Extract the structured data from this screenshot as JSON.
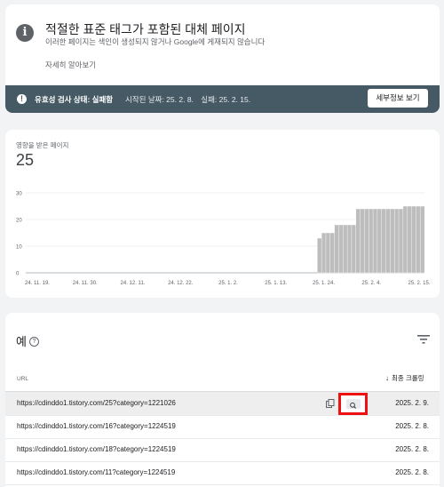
{
  "issue": {
    "title": "적절한 표준 태그가 포함된 대체 페이지",
    "description": "이러한 페이지는 색인이 생성되지 않거나 Google에 게재되지 않습니다",
    "learn_more": "자세히 알아보기",
    "status": {
      "label": "유효성 검사 상태: 실패함",
      "started": "시작된 날짜: 25. 2. 8.",
      "failed": "실패: 25. 2. 15.",
      "details_button": "세부정보 보기"
    }
  },
  "chart_card": {
    "label": "영향을 받은 페이지",
    "total": "25"
  },
  "chart_data": {
    "type": "bar",
    "title": "",
    "ylim": [
      0,
      30
    ],
    "y_ticks": [
      "0",
      "10",
      "20",
      "30"
    ],
    "x_tick_labels": [
      "24. 11. 19.",
      "24. 11. 30.",
      "24. 12. 11.",
      "24. 12. 22.",
      "25. 1. 2.",
      "25. 1. 13.",
      "25. 1. 24.",
      "25. 2. 4.",
      "25. 2. 15."
    ],
    "grid": true,
    "series": [
      {
        "values": [
          0,
          0,
          0,
          0,
          0,
          0,
          0,
          0,
          0,
          0,
          0,
          0,
          0,
          0,
          0,
          0,
          0,
          0,
          0,
          0,
          0,
          0,
          0,
          0,
          0,
          0,
          0,
          0,
          0,
          0,
          0,
          0,
          0,
          0,
          0,
          0,
          0,
          0,
          0,
          0,
          0,
          0,
          0,
          0,
          0,
          0,
          0,
          0,
          0,
          0,
          0,
          0,
          0,
          0,
          0,
          0,
          0,
          0,
          0,
          0,
          0,
          0,
          0,
          0,
          0,
          0,
          0,
          0,
          13,
          15,
          15,
          15,
          18,
          18,
          18,
          18,
          18,
          24,
          24,
          24,
          24,
          24,
          24,
          24,
          24,
          24,
          24,
          24,
          25,
          25,
          25,
          25,
          25
        ]
      }
    ]
  },
  "table": {
    "title": "예",
    "columns": {
      "url": "URL",
      "last_crawled": "최종 크롤링"
    },
    "rows": [
      {
        "url": "https://cdinddo1.tistory.com/25?category=1221026",
        "date": "2025. 2. 9."
      },
      {
        "url": "https://cdinddo1.tistory.com/16?category=1224519",
        "date": "2025. 2. 8."
      },
      {
        "url": "https://cdinddo1.tistory.com/18?category=1224519",
        "date": "2025. 2. 8."
      },
      {
        "url": "https://cdinddo1.tistory.com/11?category=1224519",
        "date": "2025. 2. 8."
      }
    ]
  },
  "colors": {
    "status_bar": "#455a64",
    "bar_fill": "#bdbdbd",
    "highlight_box": "#ee1111"
  },
  "icons": {
    "issue": "info-icon",
    "status": "exclamation-icon",
    "help": "help-icon",
    "filter": "filter-icon",
    "copy": "copy-icon",
    "inspect": "search-icon"
  }
}
